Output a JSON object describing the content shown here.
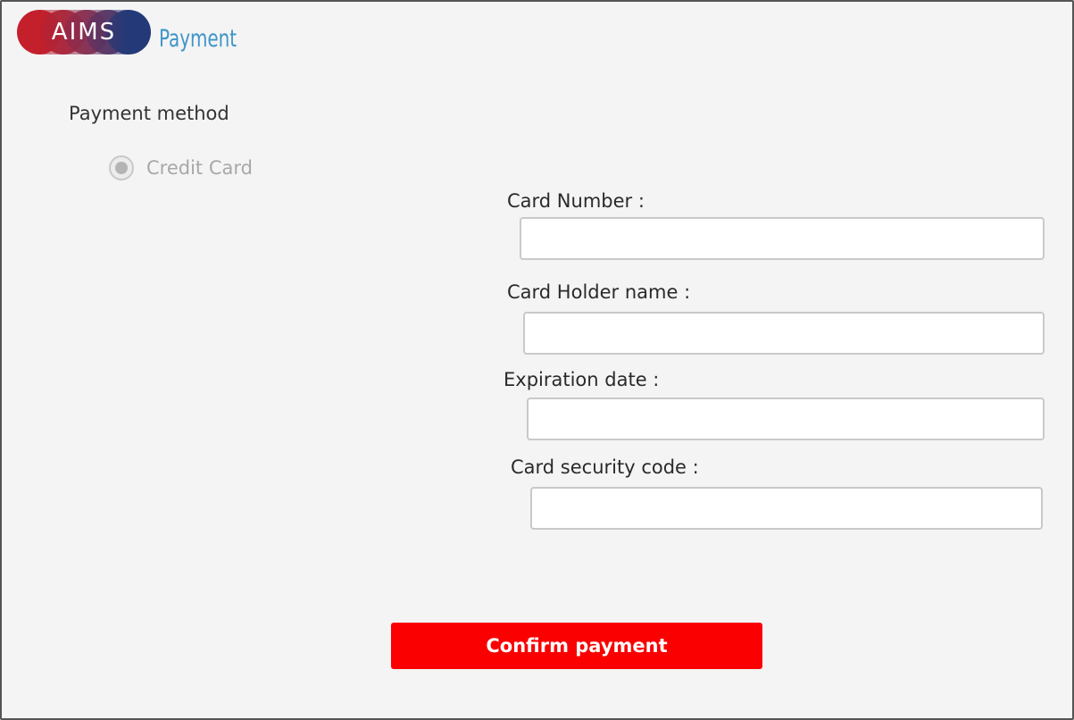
{
  "header": {
    "logo_text": "AIMS",
    "title": "Payment"
  },
  "payment_method": {
    "label": "Payment method",
    "options": [
      {
        "label": "Credit Card",
        "selected": true,
        "disabled": true
      }
    ]
  },
  "form": {
    "card_number_label": "Card Number :",
    "card_number_value": "",
    "card_holder_label": "Card Holder name :",
    "card_holder_value": "",
    "expiration_label": "Expiration date :",
    "expiration_value": "",
    "security_code_label": "Card security code :",
    "security_code_value": ""
  },
  "actions": {
    "confirm_label": "Confirm payment"
  },
  "colors": {
    "accent_title": "#3d95c9",
    "confirm_button": "#fb0000",
    "logo_gradient": [
      "#c31e2a",
      "#8a2d4f",
      "#1f3a78"
    ]
  }
}
